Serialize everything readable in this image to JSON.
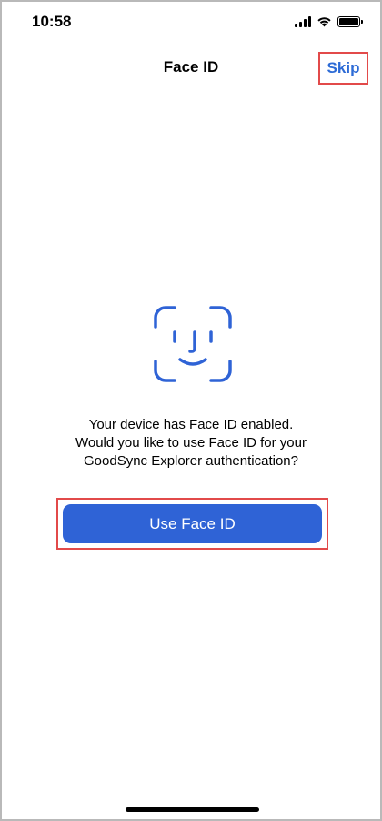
{
  "status_bar": {
    "time": "10:58",
    "icons": [
      "cellular-signal-icon",
      "wifi-icon",
      "battery-icon"
    ],
    "battery_level": 1.0
  },
  "nav": {
    "title": "Face ID",
    "skip_label": "Skip"
  },
  "content": {
    "icon": "face-id-icon",
    "message_lines": [
      "Your device has Face ID enabled.",
      "Would you like to use Face ID for your",
      "GoodSync Explorer authentication?"
    ],
    "button_label": "Use Face ID"
  },
  "colors": {
    "accent": "#2f63d6",
    "link": "#2d6bd6",
    "highlight_border": "#e24a4a",
    "background": "#ffffff"
  }
}
